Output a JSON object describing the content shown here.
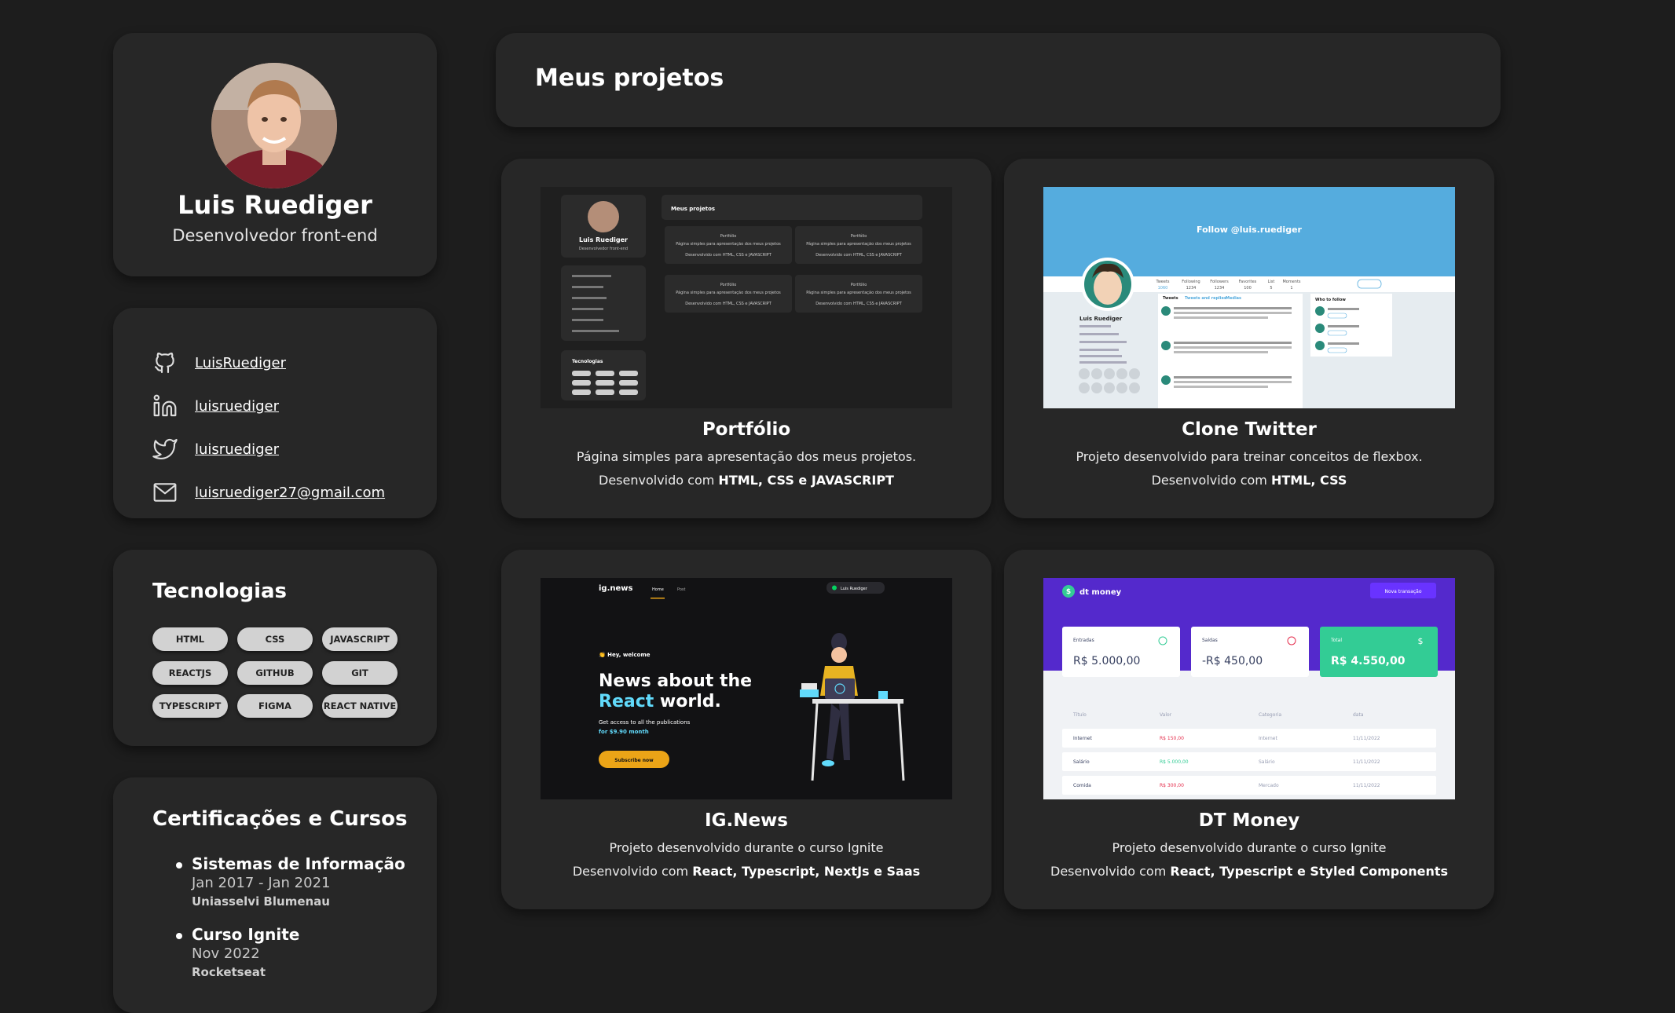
{
  "profile": {
    "name": "Luis Ruediger",
    "role": "Desenvolvedor front-end"
  },
  "links": {
    "github": "LuisRuediger",
    "linkedin": "luisruediger",
    "twitter": "luisruediger",
    "email": "luisruediger27@gmail.com"
  },
  "tech": {
    "title": "Tecnologias",
    "items": [
      "HTML",
      "CSS",
      "JAVASCRIPT",
      "REACTJS",
      "GITHUB",
      "GIT",
      "TYPESCRIPT",
      "FIGMA",
      "REACT NATIVE"
    ]
  },
  "certs": {
    "title": "Certificações e Cursos",
    "items": [
      {
        "name": "Sistemas de Informação",
        "date": "Jan 2017 - Jan 2021",
        "institution": "Uniasselvi Blumenau"
      },
      {
        "name": "Curso Ignite",
        "date": "Nov 2022",
        "institution": "Rocketseat"
      }
    ]
  },
  "projects": {
    "title": "Meus projetos",
    "dev_prefix": "Desenvolvido com",
    "items": [
      {
        "title": "Portfólio",
        "desc": "Página simples para apresentação dos meus projetos.",
        "tech": "HTML, CSS e JAVASCRIPT"
      },
      {
        "title": "Clone Twitter",
        "desc": "Projeto desenvolvido para treinar conceitos de flexbox.",
        "tech": "HTML, CSS"
      },
      {
        "title": "IG.News",
        "desc": "Projeto desenvolvido durante o curso Ignite",
        "tech": "React, Typescript, NextJs e Saas"
      },
      {
        "title": "DT Money",
        "desc": "Projeto desenvolvido durante o curso Ignite",
        "tech": "React, Typescript e Styled Components"
      }
    ]
  },
  "thumbs": {
    "portfolio": {
      "name": "Luis Ruediger",
      "role": "Desenvolvedor front-end",
      "header": "Meus projetos",
      "card_title": "Portfólio",
      "card_desc": "Página simples para apresentação dos meus projetos.",
      "card_tech": "Desenvolvido com HTML, CSS e JAVASCRIPT",
      "tech_title": "Tecnologias"
    },
    "twitter": {
      "banner": "Follow @luis.ruediger",
      "name": "Luis Ruediger",
      "tabs": [
        "Tweets",
        "Following",
        "Followers",
        "Favorites",
        "List",
        "Moments"
      ],
      "counts": [
        "1060",
        "1234",
        "1234",
        "100",
        "5",
        "1"
      ],
      "feed_tabs": [
        "Tweets",
        "Tweets and replies",
        "Medias"
      ],
      "who_to_follow": "Who to follow",
      "follow_btn": "Follow"
    },
    "ignews": {
      "logo": "ig.news",
      "nav": [
        "Home",
        "Post"
      ],
      "user": "Luis Ruediger",
      "welcome": "👏 Hey, welcome",
      "headline1": "News about the",
      "headline2a": "React",
      "headline2b": " world.",
      "sub1": "Get access to all the publications",
      "sub2": "for $9.90 month",
      "cta": "Subscribe now"
    },
    "dtmoney": {
      "logo": "dt money",
      "new_btn": "Nova transação",
      "cards": [
        {
          "label": "Entradas",
          "value": "R$ 5.000,00"
        },
        {
          "label": "Saídas",
          "value": "-R$ 450,00"
        },
        {
          "label": "Total",
          "value": "R$ 4.550,00"
        }
      ],
      "cols": [
        "Título",
        "Valor",
        "Categoria",
        "data"
      ],
      "rows": [
        [
          "Internet",
          "R$ 150,00",
          "Internet",
          "11/11/2022"
        ],
        [
          "Salário",
          "R$ 5.000,00",
          "Salário",
          "11/11/2022"
        ],
        [
          "Comida",
          "R$ 300,00",
          "Mercado",
          "11/11/2022"
        ]
      ]
    }
  },
  "colors": {
    "bg": "#1d1d1d",
    "card": "#272727",
    "pill": "#d2d2d2",
    "twitter_blue": "#55acde",
    "react_blue": "#61dafb",
    "ignews_yellow": "#eba417",
    "dt_purple": "#5429cc",
    "dt_green": "#33cc95",
    "dt_red": "#e52e4d"
  }
}
